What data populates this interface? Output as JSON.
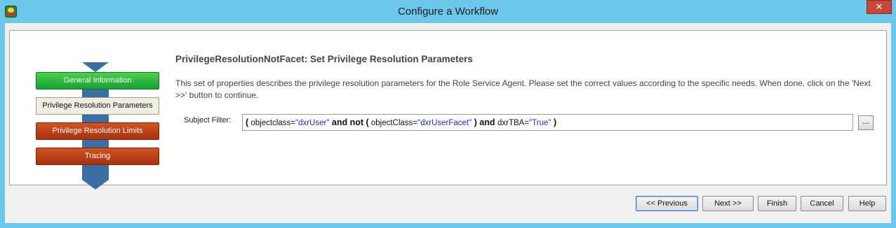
{
  "window": {
    "title": "Configure a Workflow",
    "close_symbol": "✕"
  },
  "steps": [
    {
      "label": "General Information",
      "state": "complete",
      "color": "#1cab3a"
    },
    {
      "label": "Privilege Resolution Parameters",
      "state": "current",
      "color": "#efeee0"
    },
    {
      "label": "Privilege Resolution Limits",
      "state": "pending",
      "color": "#b93d15"
    },
    {
      "label": "Tracing",
      "state": "pending",
      "color": "#b93d15"
    }
  ],
  "main": {
    "heading": "PrivilegeResolutionNotFacet: Set Privilege Resolution Parameters",
    "description": "This set of properties describes the privilege resolution parameters for the Role Service Agent. Please set the correct values according to the specific needs.  When done, click on the 'Next >>' button to continue.",
    "subject_filter": {
      "label": "Subject Filter:",
      "tokens": {
        "open1": "(",
        "attr1": " objectclass=",
        "val1": "\"dxrUser\"",
        "and_not": " and not ",
        "open2": "(",
        "attr2": " objectClass=",
        "val2": "\"dxrUserFacet\"",
        "close2": " )",
        "and": " and ",
        "attr3": "dxrTBA=",
        "val3": "\"True\"",
        "close1": " )"
      },
      "browse_label": "..."
    }
  },
  "buttons": {
    "previous": "<< Previous",
    "next": "Next >>",
    "finish": "Finish",
    "cancel": "Cancel",
    "help": "Help"
  },
  "colors": {
    "titlebar": "#6cc8ea",
    "arrow": "#3a6ea5",
    "value_text": "#1a2fd0",
    "close_button": "#c7483a"
  }
}
